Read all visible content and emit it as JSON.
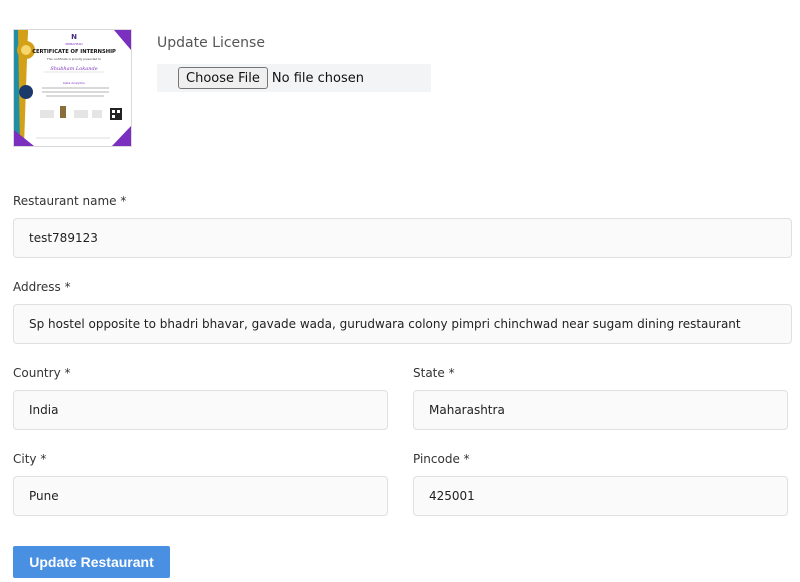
{
  "license": {
    "label": "Update License",
    "choose_file_label": "Choose File",
    "file_status": "No file chosen"
  },
  "certificate_thumbnail": {
    "brand": "WEBAHEAD",
    "title": "CERTIFICATE OF INTERNSHIP",
    "subtitle": "This certificate is proudly presented to",
    "name": "Shubham Lokande",
    "course": "Data Analytics"
  },
  "form": {
    "restaurant_name": {
      "label": "Restaurant name *",
      "value": "test789123"
    },
    "address": {
      "label": "Address *",
      "value": "Sp hostel opposite to bhadri bhavar, gavade wada, gurudwara colony pimpri chinchwad near sugam dining restaurant"
    },
    "country": {
      "label": "Country *",
      "value": "India"
    },
    "state": {
      "label": "State *",
      "value": "Maharashtra"
    },
    "city": {
      "label": "City *",
      "value": "Pune"
    },
    "pincode": {
      "label": "Pincode *",
      "value": "425001"
    }
  },
  "submit_label": "Update Restaurant",
  "colors": {
    "accent": "#4a90e2",
    "cert_purple": "#7b2fbf",
    "cert_gold": "#d4a017",
    "cert_teal": "#1f8fa3"
  }
}
